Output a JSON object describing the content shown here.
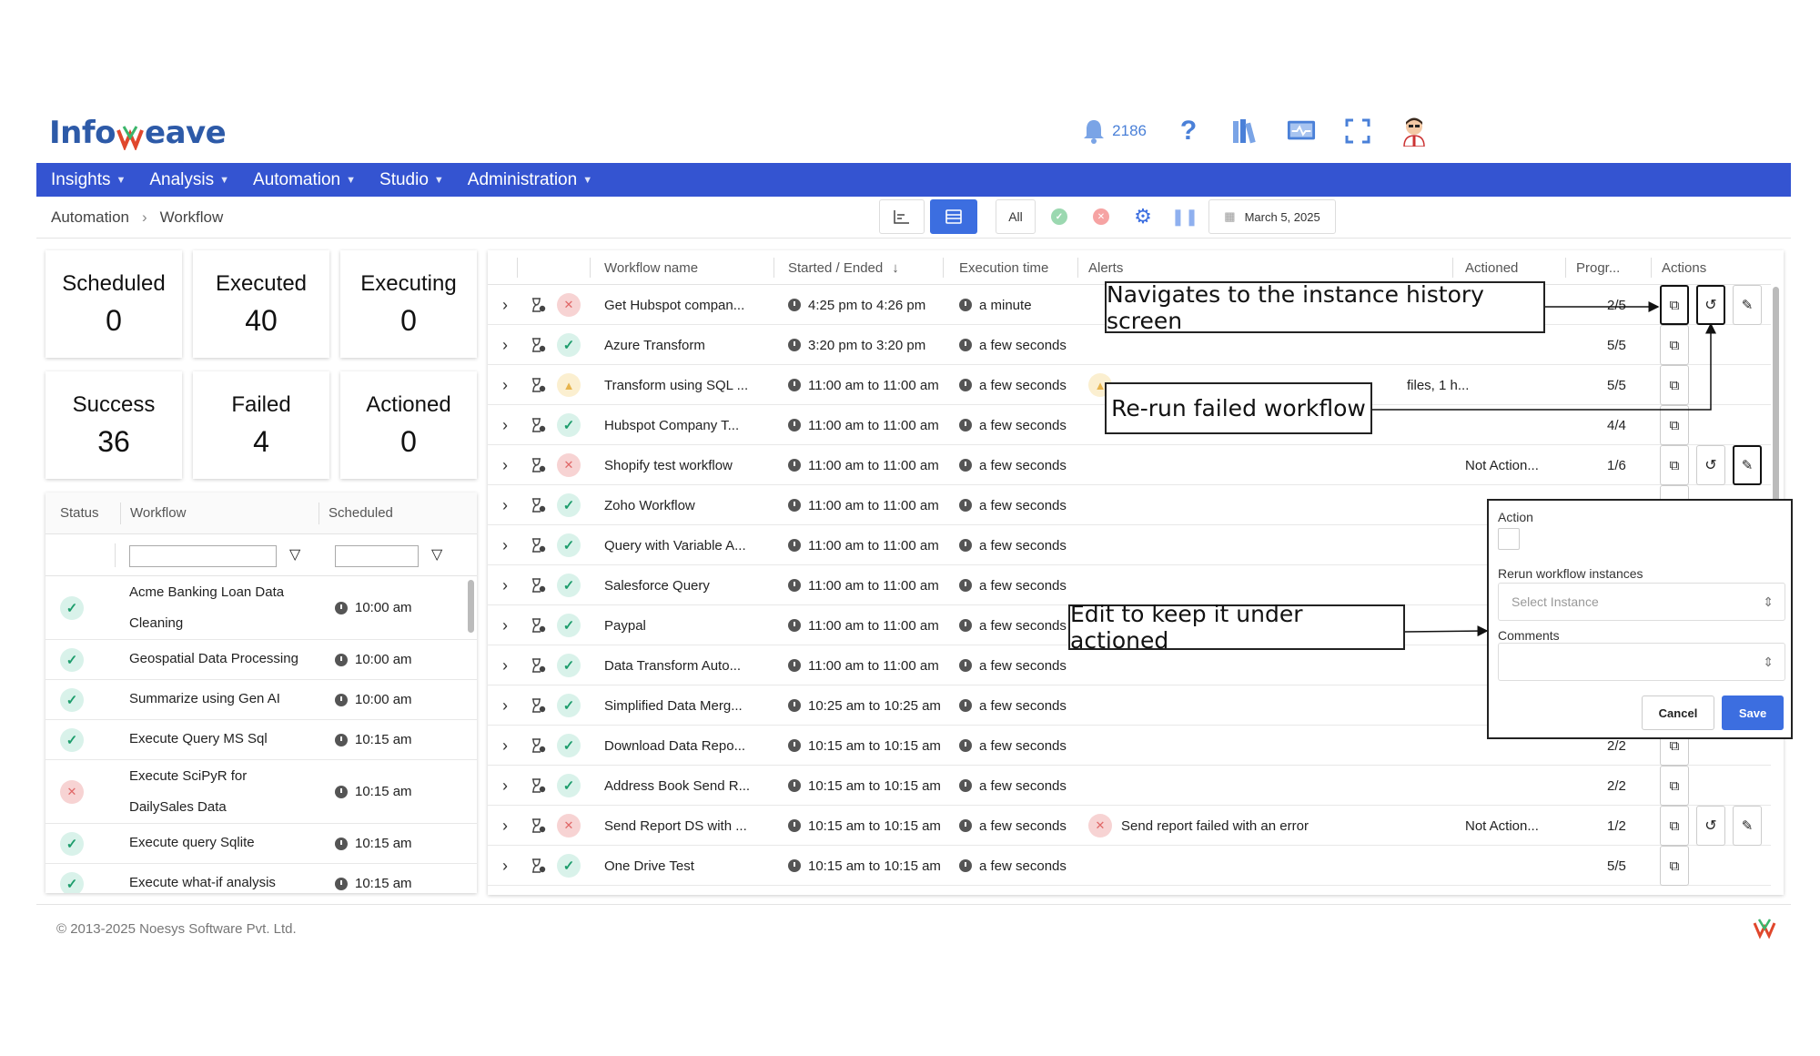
{
  "header": {
    "logo_text": "Info",
    "logo_text2": "eave",
    "notifications": "2186"
  },
  "menu": [
    {
      "label": "Insights"
    },
    {
      "label": "Analysis"
    },
    {
      "label": "Automation"
    },
    {
      "label": "Studio"
    },
    {
      "label": "Administration"
    }
  ],
  "breadcrumb": {
    "root": "Automation",
    "current": "Workflow"
  },
  "toolbar": {
    "all_label": "All",
    "date": "March 5, 2025"
  },
  "cards": [
    {
      "label": "Scheduled",
      "value": "0"
    },
    {
      "label": "Executed",
      "value": "40"
    },
    {
      "label": "Executing",
      "value": "0"
    },
    {
      "label": "Success",
      "value": "36"
    },
    {
      "label": "Failed",
      "value": "4"
    },
    {
      "label": "Actioned",
      "value": "0"
    }
  ],
  "left_table": {
    "headers": {
      "status": "Status",
      "workflow": "Workflow",
      "scheduled": "Scheduled"
    },
    "rows": [
      {
        "status": "success",
        "name": "Acme Banking Loan Data Cleaning",
        "time": "10:00 am"
      },
      {
        "status": "success",
        "name": "Geospatial Data Processing",
        "time": "10:00 am"
      },
      {
        "status": "success",
        "name": "Summarize using Gen AI",
        "time": "10:00 am"
      },
      {
        "status": "success",
        "name": "Execute Query MS Sql",
        "time": "10:15 am"
      },
      {
        "status": "failed",
        "name": "Execute SciPyR for DailySales Data",
        "time": "10:15 am"
      },
      {
        "status": "success",
        "name": "Execute query Sqlite",
        "time": "10:15 am"
      },
      {
        "status": "success",
        "name": "Execute what-if analysis sales",
        "time": "10:15 am"
      }
    ]
  },
  "main_table": {
    "headers": {
      "name": "Workflow name",
      "started": "Started / Ended",
      "exec": "Execution time",
      "alerts": "Alerts",
      "actioned": "Actioned",
      "progress": "Progr...",
      "actions": "Actions"
    },
    "rows": [
      {
        "status": "failed",
        "name": "Get Hubspot compan...",
        "started": "4:25 pm to 4:26 pm",
        "exec": "a minute",
        "alert": "",
        "actioned": "",
        "progress": "2/5"
      },
      {
        "status": "success",
        "name": "Azure Transform",
        "started": "3:20 pm to 3:20 pm",
        "exec": "a few seconds",
        "alert": "",
        "actioned": "",
        "progress": "5/5"
      },
      {
        "status": "warn",
        "name": "Transform using SQL ...",
        "started": "11:00 am to 11:00 am",
        "exec": "a few seconds",
        "alert": "files, 1 h...",
        "actioned": "",
        "progress": "5/5"
      },
      {
        "status": "success",
        "name": "Hubspot Company T...",
        "started": "11:00 am to 11:00 am",
        "exec": "a few seconds",
        "alert": "",
        "actioned": "",
        "progress": "4/4"
      },
      {
        "status": "failed",
        "name": "Shopify test workflow",
        "started": "11:00 am to 11:00 am",
        "exec": "a few seconds",
        "alert": "",
        "actioned": "Not Action...",
        "progress": "1/6"
      },
      {
        "status": "success",
        "name": "Zoho Workflow",
        "started": "11:00 am to 11:00 am",
        "exec": "a few seconds",
        "alert": "",
        "actioned": "",
        "progress": ""
      },
      {
        "status": "success",
        "name": "Query with Variable A...",
        "started": "11:00 am to 11:00 am",
        "exec": "a few seconds",
        "alert": "",
        "actioned": "",
        "progress": ""
      },
      {
        "status": "success",
        "name": "Salesforce Query",
        "started": "11:00 am to 11:00 am",
        "exec": "a few seconds",
        "alert": "",
        "actioned": "",
        "progress": ""
      },
      {
        "status": "success",
        "name": "Paypal",
        "started": "11:00 am to 11:00 am",
        "exec": "a few seconds",
        "alert": "",
        "actioned": "",
        "progress": ""
      },
      {
        "status": "success",
        "name": "Data Transform Auto...",
        "started": "11:00 am to 11:00 am",
        "exec": "a few seconds",
        "alert": "",
        "actioned": "",
        "progress": ""
      },
      {
        "status": "success",
        "name": "Simplified Data Merg...",
        "started": "10:25 am to 10:25 am",
        "exec": "a few seconds",
        "alert": "",
        "actioned": "",
        "progress": ""
      },
      {
        "status": "success",
        "name": "Download Data Repo...",
        "started": "10:15 am to 10:15 am",
        "exec": "a few seconds",
        "alert": "",
        "actioned": "",
        "progress": "2/2"
      },
      {
        "status": "success",
        "name": "Address Book Send R...",
        "started": "10:15 am to 10:15 am",
        "exec": "a few seconds",
        "alert": "",
        "actioned": "",
        "progress": "2/2"
      },
      {
        "status": "failed",
        "name": "Send Report DS with ...",
        "started": "10:15 am to 10:15 am",
        "exec": "a few seconds",
        "alert": "Send report failed with an error",
        "actioned": "Not Action...",
        "progress": "1/2"
      },
      {
        "status": "success",
        "name": "One Drive Test",
        "started": "10:15 am to 10:15 am",
        "exec": "a few seconds",
        "alert": "",
        "actioned": "",
        "progress": "5/5"
      }
    ]
  },
  "callouts": {
    "history": "Navigates to the instance history screen",
    "rerun": "Re-run failed workflow",
    "edit": "Edit to keep it under actioned"
  },
  "popup": {
    "action_label": "Action",
    "rerun_label": "Rerun workflow instances",
    "select_placeholder": "Select Instance",
    "comments_label": "Comments",
    "cancel": "Cancel",
    "save": "Save"
  },
  "footer": {
    "copyright": "© 2013-2025 Noesys Software Pvt. Ltd."
  },
  "colors": {
    "brand_blue": "#3454d1",
    "success": "#1d9d6c",
    "failed": "#e06767",
    "warn": "#e7b44c"
  }
}
